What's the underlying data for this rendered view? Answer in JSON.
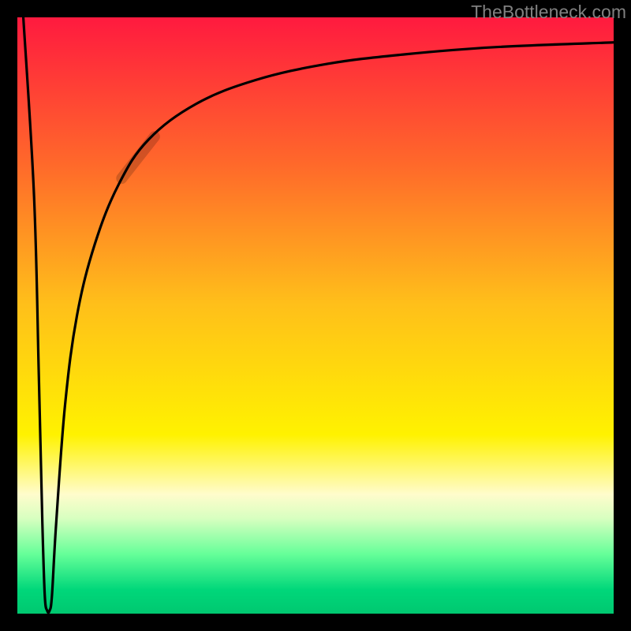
{
  "watermark": "TheBottleneck.com",
  "chart_data": {
    "type": "line",
    "title": "",
    "xlabel": "",
    "ylabel": "",
    "xlim": [
      0,
      100
    ],
    "ylim": [
      0,
      100
    ],
    "background_gradient": {
      "stops": [
        {
          "offset": 0.0,
          "color": "#ff1a3f"
        },
        {
          "offset": 0.25,
          "color": "#ff6a2a"
        },
        {
          "offset": 0.48,
          "color": "#ffbf1a"
        },
        {
          "offset": 0.7,
          "color": "#fff200"
        },
        {
          "offset": 0.8,
          "color": "#fffccc"
        },
        {
          "offset": 0.84,
          "color": "#d8ffc0"
        },
        {
          "offset": 0.9,
          "color": "#66ff99"
        },
        {
          "offset": 0.96,
          "color": "#00d77a"
        },
        {
          "offset": 1.0,
          "color": "#00c870"
        }
      ]
    },
    "series": [
      {
        "name": "bottleneck-curve",
        "points": [
          {
            "x": 1.0,
            "y": 100
          },
          {
            "x": 2.8,
            "y": 70
          },
          {
            "x": 3.6,
            "y": 40
          },
          {
            "x": 4.2,
            "y": 15
          },
          {
            "x": 4.6,
            "y": 3
          },
          {
            "x": 5.0,
            "y": 0.5
          },
          {
            "x": 5.4,
            "y": 0.5
          },
          {
            "x": 5.8,
            "y": 3
          },
          {
            "x": 6.5,
            "y": 15
          },
          {
            "x": 8.0,
            "y": 35
          },
          {
            "x": 10.0,
            "y": 50
          },
          {
            "x": 13.0,
            "y": 62
          },
          {
            "x": 17.0,
            "y": 72
          },
          {
            "x": 22.0,
            "y": 79.5
          },
          {
            "x": 30.0,
            "y": 85.5
          },
          {
            "x": 40.0,
            "y": 89.5
          },
          {
            "x": 52.0,
            "y": 92.2
          },
          {
            "x": 65.0,
            "y": 93.8
          },
          {
            "x": 80.0,
            "y": 95.0
          },
          {
            "x": 100.0,
            "y": 95.8
          }
        ]
      },
      {
        "name": "highlight-segment",
        "color": "rgba(0,0,0,0.18)",
        "width": 14,
        "points": [
          {
            "x": 17.5,
            "y": 73
          },
          {
            "x": 23.0,
            "y": 80
          }
        ]
      }
    ]
  },
  "colors": {
    "frame": "#000000",
    "curve": "#000000"
  },
  "plot": {
    "outer": 800,
    "frame": 22,
    "inner": 756
  }
}
